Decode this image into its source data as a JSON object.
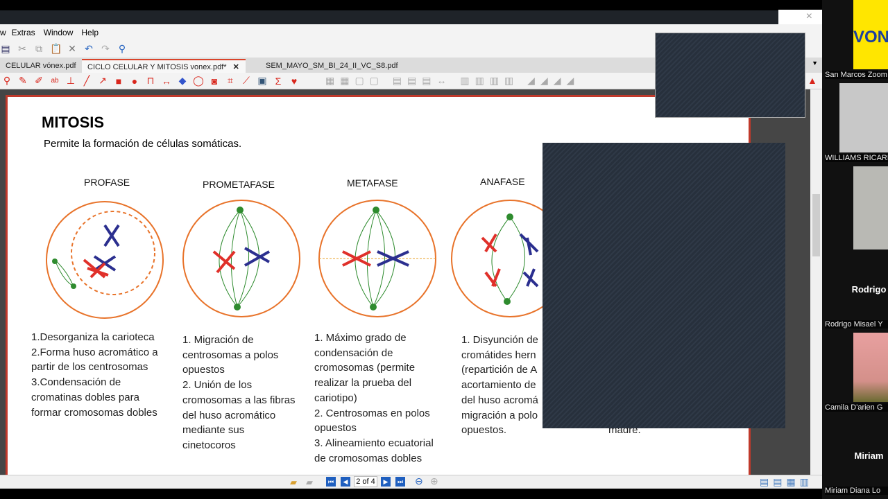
{
  "window": {
    "close_icon": "×"
  },
  "menu": [
    "w",
    "Extras",
    "Window",
    "Help"
  ],
  "tabs": [
    "CELULAR vónex.pdf",
    "CICLO CELULAR Y MITOSIS vonex.pdf*",
    "SEM_MAYO_SM_BI_24_II_VC_S8.pdf"
  ],
  "tab_close": "✕",
  "document": {
    "title": "MITOSIS",
    "subtitle": "Permite la formación de células somáticas.",
    "phases": [
      {
        "name": "PROFASE",
        "text": "1.Desorganiza la carioteca\n2.Forma huso acromático a\npartir de los centrosomas\n3.Condensación de\ncromatinas dobles para\nformar cromosomas dobles"
      },
      {
        "name": "PROMETAFASE",
        "text": "1. Migración de\ncentrosomas a polos\nopuestos\n2. Unión de los\ncromosomas a las fibras\ndel huso acromático\nmediante sus\ncinetocoros"
      },
      {
        "name": "METAFASE",
        "text": "1. Máximo grado de\ncondensación de\ncromosomas (permite\nrealizar la prueba del\ncariotipo)\n2. Centrosomas en polos\nopuestos\n3. Alineamiento ecuatorial\nde cromosomas dobles"
      },
      {
        "name": "ANAFASE",
        "text": "1. Disyunción de\ncromátides hern\n(repartición de A\nacortamiento de\ndel huso acromá\nmigración a polo\nopuestos."
      }
    ],
    "partial_text": "madre."
  },
  "status": {
    "page": "2 of 4"
  },
  "participants": [
    {
      "name": "San Marcos Zoom",
      "logo": "VON"
    },
    {
      "name": "WILLIAMS RICARDO"
    },
    {
      "name": "Rodrigo",
      "full": "Rodrigo Misael Y"
    },
    {
      "name": "Camila D'arien G"
    },
    {
      "name": "Miriam",
      "full": "Miriam Diana Lo"
    }
  ],
  "colors": {
    "accent": "#d9442b",
    "cell": "#e8732a",
    "spindle": "#2e8b2e",
    "chrom_red": "#e0302a",
    "chrom_blue": "#2b2f8f"
  }
}
